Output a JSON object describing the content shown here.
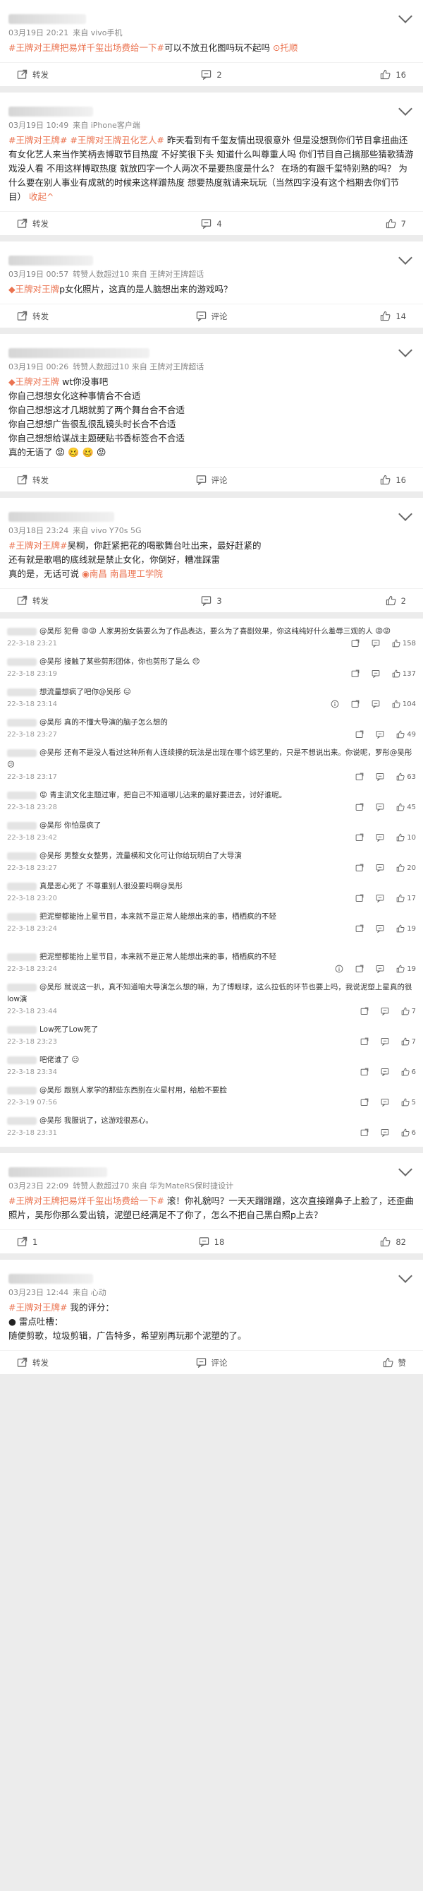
{
  "posts1": [
    {
      "meta": {
        "date": "03月19日 20:21",
        "source": "来自 vivo手机"
      },
      "body": [
        {
          "t": "tag",
          "v": "#王牌对王牌把易烊千玺出场费给一下#"
        },
        {
          "t": "text",
          "v": "可以不放丑化图吗玩不起吗 "
        },
        {
          "t": "link",
          "v": "⊙托顺"
        }
      ],
      "actions": {
        "repost": "转发",
        "comment": "2",
        "like": "16"
      }
    },
    {
      "meta": {
        "date": "03月19日 10:49",
        "source": "来自 iPhone客户端"
      },
      "body": [
        {
          "t": "tag",
          "v": "#王牌对王牌# #王牌对王牌丑化艺人#"
        },
        {
          "t": "text",
          "v": " 昨天看到有千玺友情出现很意外 但是没想到你们节目拿扭曲还有女化艺人来当作笑柄去博取节目热度 不好笑很下头 知道什么叫尊重人吗 你们节目自己搞那些猜歌猜游戏没人看 不用这样博取热度 就放四字一个人两次不是要热度是什么？ 在场的有跟千玺特别熟的吗？ 为什么要在别人事业有成就的时候来这样蹭热度 想要热度就请来玩玩（当然四字没有这个档期去你们节目） "
        },
        {
          "t": "link",
          "v": "收起^"
        }
      ],
      "actions": {
        "repost": "转发",
        "comment": "4",
        "like": "7"
      }
    },
    {
      "meta": {
        "date": "03月19日 00:57",
        "source": "转赞人数超过10 来自 王牌对王牌超话"
      },
      "body": [
        {
          "t": "tag",
          "v": "◆王牌对王牌"
        },
        {
          "t": "text",
          "v": "p女化照片，这真的是人脑想出来的游戏吗？"
        }
      ],
      "actions": {
        "repost": "转发",
        "comment": "评论",
        "like": "14"
      }
    },
    {
      "meta": {
        "date": "03月19日 00:26",
        "source": "转赞人数超过10 来自 王牌对王牌超话"
      },
      "body": [
        {
          "t": "tag",
          "v": "◆王牌对王牌"
        },
        {
          "t": "text",
          "v": " wt你没事吧"
        },
        {
          "t": "br",
          "v": ""
        },
        {
          "t": "text",
          "v": "你自己想想女化这种事情合不合适"
        },
        {
          "t": "br",
          "v": ""
        },
        {
          "t": "text",
          "v": "你自己想想这才几期就剪了两个舞台合不合适"
        },
        {
          "t": "br",
          "v": ""
        },
        {
          "t": "text",
          "v": "你自己想想广告很乱很乱镜头时长合不合适"
        },
        {
          "t": "br",
          "v": ""
        },
        {
          "t": "text",
          "v": "你自己想想给谋战主题硬贴书香标签合不合适"
        },
        {
          "t": "br",
          "v": ""
        },
        {
          "t": "text",
          "v": "真的无语了"
        }
      ],
      "emojis_after": "😡 🥴 🥴 😡",
      "actions": {
        "repost": "转发",
        "comment": "评论",
        "like": "16"
      }
    },
    {
      "meta": {
        "date": "03月18日 23:24",
        "source": "来自 vivo Y70s 5G"
      },
      "body": [
        {
          "t": "tag",
          "v": "#王牌对王牌#"
        },
        {
          "t": "text",
          "v": "吴桐，你赶紧把花的喝歌舞台吐出来，最好赶紧的"
        },
        {
          "t": "br",
          "v": ""
        },
        {
          "t": "text",
          "v": "还有就是歌唱的底线就是禁止女化，你倒好，糟准踩雷 "
        },
        {
          "t": "br",
          "v": ""
        },
        {
          "t": "text",
          "v": "真的是，无话可说 "
        },
        {
          "t": "link",
          "v": "◉南昌 南昌理工学院"
        }
      ],
      "actions": {
        "repost": "转发",
        "comment": "3",
        "like": "2"
      }
    }
  ],
  "comments": [
    {
      "text": "@吴彤 犯骨 😡😡 人家男扮女装要么为了作品表达，要么为了喜剧效果，你这纯纯好什么羞辱三观的人 😡😡",
      "time": "22-3-18 23:21",
      "like": "158",
      "extra": ""
    },
    {
      "text": "@吴彤 接触了某些剪形团体，你也剪形了是么 😞",
      "time": "22-3-18 23:19",
      "like": "137",
      "extra": ""
    },
    {
      "text": "想流量想疯了吧你@吴彤 😑",
      "time": "22-3-18 23:14",
      "like": "104",
      "extra": "info"
    },
    {
      "text": "@吴彤 真的不懂大导演的脑子怎么想的",
      "time": "22-3-18 23:27",
      "like": "49",
      "extra": ""
    },
    {
      "text": "@吴彤 还有不是没人看过这种所有人连续摸的玩法是出现在哪个综艺里的，只是不想说出来。你说呢，罗彤@吴彤 😕",
      "time": "22-3-18 23:17",
      "like": "63",
      "extra": ""
    },
    {
      "text": "😡 青主流文化主题过审，把自己不知道哪儿沾来的最好要进去，讨好谁呢。",
      "time": "22-3-18 23:28",
      "like": "45",
      "extra": ""
    },
    {
      "text": "@吴彤 你怕是疯了",
      "time": "22-3-18 23:42",
      "like": "10",
      "extra": ""
    },
    {
      "text": "@吴彤 男整女女整男，流量横和文化可让你给玩明白了大导演",
      "time": "22-3-18 23:27",
      "like": "20",
      "extra": ""
    },
    {
      "text": "真是恶心死了 不尊重别人很没要吗啊@吴彤",
      "time": "22-3-18 23:20",
      "like": "17",
      "extra": ""
    },
    {
      "text": "把泥塑都能抬上星节目，本来就不是正常人能想出来的事，栖栖疯的不轻",
      "time": "22-3-18 23:24",
      "like": "19",
      "extra": ""
    },
    {
      "text": "把泥塑都能抬上星节目，本来就不是正常人能想出来的事，栖栖疯的不轻",
      "time": "22-3-18 23:24",
      "like": "19",
      "extra": "info"
    },
    {
      "text": "@吴彤 就说这一扒，真不知道咱大导演怎么想的嘛，为了博眼球，这么拉低的环节也要上吗，我说泥塑上星真的很low演",
      "time": "22-3-18 23:44",
      "like": "7",
      "extra": ""
    },
    {
      "text": "Low死了Low死了",
      "time": "22-3-18 23:23",
      "like": "7",
      "extra": ""
    },
    {
      "text": "吧佬谁了 😐",
      "time": "22-3-18 23:34",
      "like": "6",
      "extra": ""
    },
    {
      "text": "@吴彤 跟别人家学的那些东西别在火星村用，给脸不要脸",
      "time": "22-3-19 07:56",
      "like": "5",
      "extra": ""
    },
    {
      "text": "@吴彤 我服说了，这游戏很恶心。",
      "time": "22-3-18 23:31",
      "like": "6",
      "extra": ""
    }
  ],
  "posts2": [
    {
      "meta": {
        "date": "03月23日 22:09",
        "source": "转赞人数超过70 来自 华为MateRS保时捷设计"
      },
      "body": [
        {
          "t": "tag",
          "v": "#王牌对王牌把易烊千玺出场费给一下#"
        },
        {
          "t": "text",
          "v": " 滚！你礼貌吗？一天天蹭蹭蹭，这次直接蹭鼻子上脸了，还歪曲照片，吴彤你那么爱出镜，泥塑已经满足不了你了，怎么不把自己黑白照p上去？"
        }
      ],
      "actions": {
        "repost": "1",
        "comment": "18",
        "like": "82"
      }
    },
    {
      "meta": {
        "date": "03月23日 12:44",
        "source": "来自 心动"
      },
      "body": [
        {
          "t": "tag",
          "v": "#王牌对王牌#"
        },
        {
          "t": "text",
          "v": " 我的评分："
        },
        {
          "t": "br",
          "v": ""
        },
        {
          "t": "text",
          "v": "● 雷点吐槽："
        },
        {
          "t": "br",
          "v": ""
        },
        {
          "t": "text",
          "v": "随便剪歌，垃圾剪辑，广告特多，希望别再玩那个泥塑的了。"
        }
      ],
      "actions": {
        "repost": "转发",
        "comment": "评论",
        "like": "赞"
      }
    }
  ],
  "icons": {
    "repost": "repost-icon",
    "comment": "comment-icon",
    "like": "like-icon",
    "chevron": "chevron-down-icon"
  },
  "colors": {
    "accent": "#eb7350",
    "meta": "#888888"
  }
}
